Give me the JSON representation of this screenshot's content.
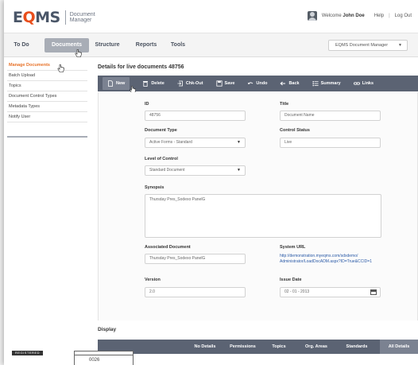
{
  "header": {
    "logo_text_e": "E",
    "logo_text_o": "Q",
    "logo_text_ms": "MS",
    "logo_sub_1": "Document",
    "logo_sub_2": "Manager",
    "welcome_prefix": "Welcome",
    "user_name": "John Doe",
    "help": "Help",
    "separator": "|",
    "logout": "Log Out"
  },
  "nav": {
    "tabs": [
      {
        "label": "To Do"
      },
      {
        "label": "Documents"
      },
      {
        "label": "Structure"
      },
      {
        "label": "Reports"
      },
      {
        "label": "Tools"
      }
    ],
    "active_tab": "Documents",
    "app_select": "EQMS Document Manager"
  },
  "sidebar": {
    "items": [
      {
        "label": "Manage Documents"
      },
      {
        "label": "Batch Upload"
      },
      {
        "label": "Topics"
      },
      {
        "label": "Document Control Types"
      },
      {
        "label": "Metadata Types"
      },
      {
        "label": "Notify User"
      }
    ]
  },
  "main": {
    "title": "Details for live documents 48756",
    "toolbar": {
      "new": "New",
      "delete": "Delete",
      "checkout": "Chk-Out",
      "save": "Save",
      "undo": "Undo",
      "back": "Back",
      "summary": "Summary",
      "links": "Links"
    },
    "form": {
      "id_label": "ID",
      "id_value": "48756",
      "title_label": "Title",
      "title_placeholder": "Document Name",
      "doc_type_label": "Document Type",
      "doc_type_value": "Active Forms - Standard",
      "control_status_label": "Control Status",
      "control_status_value": "Live",
      "level_label": "Level of Control",
      "level_value": "Standard Document",
      "synopsis_label": "Synopsis",
      "synopsis_value": "Thursday Pres_Sodexo PanelG",
      "assoc_label": "Associated Document",
      "assoc_value": "Thursday Pres_Sodexo PanelG",
      "url_label": "System URL",
      "url_line1": "http://demonstration.myeqms.com/sdxdemo/",
      "url_line2": "Administrator/LoadDocADM.aspx?ID=True&CCID=1",
      "version_label": "Version",
      "version_value": "2.0",
      "issue_label": "Issue Date",
      "issue_value": "02 - 01 - 2013"
    },
    "display_title": "Display",
    "display_tabs": [
      {
        "label": "No Details"
      },
      {
        "label": "Permissions"
      },
      {
        "label": "Topics"
      },
      {
        "label": "Org. Areas"
      },
      {
        "label": "Standards"
      },
      {
        "label": "All Details"
      }
    ],
    "active_display_tab": "All Details"
  },
  "footer_stamp": {
    "registered": "REGISTERED",
    "number": "0026"
  },
  "colors": {
    "accent": "#e8732a",
    "toolbar": "#5b6373",
    "nav_active": "#a8adb6",
    "link": "#2a5aa7"
  }
}
